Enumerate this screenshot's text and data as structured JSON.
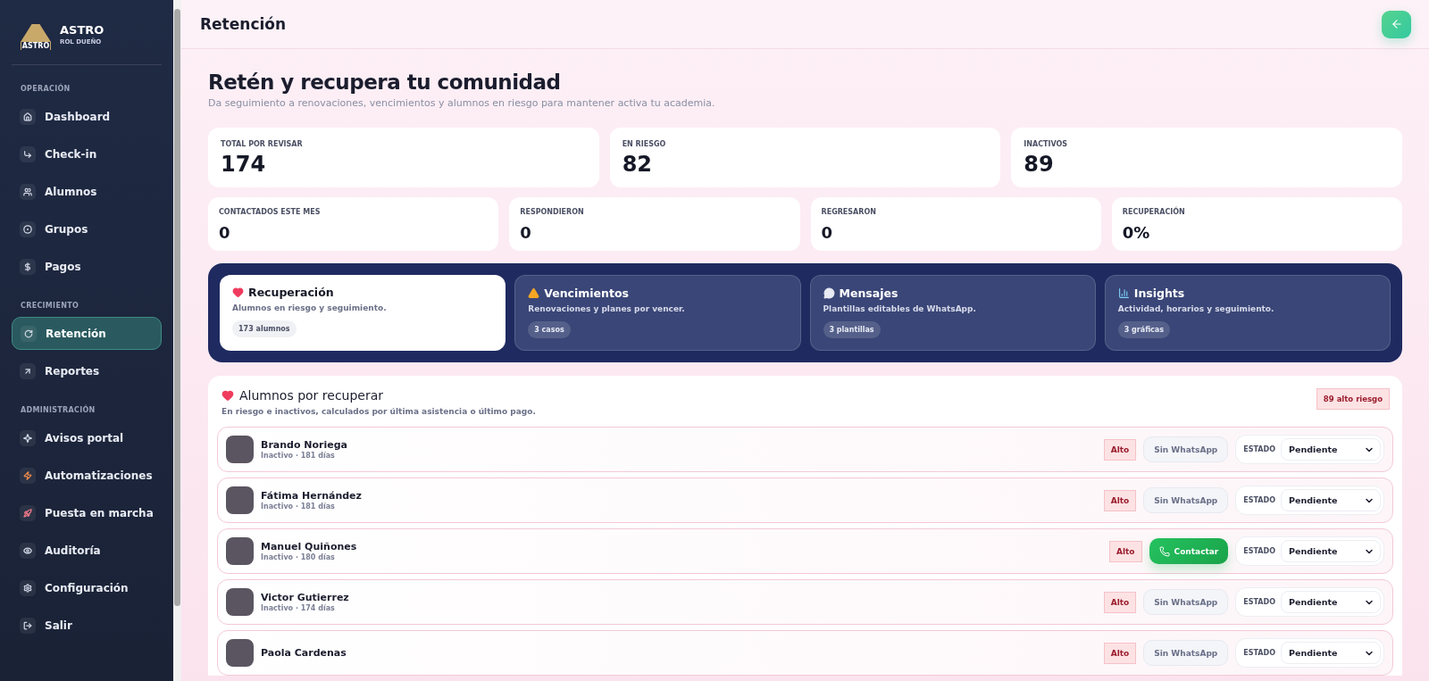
{
  "brand": {
    "name": "ASTRO",
    "logo_text": "ASTRO",
    "role": "ROL DUEÑO"
  },
  "sidebar": {
    "sections": [
      {
        "title": "OPERACIÓN",
        "items": [
          {
            "label": "Dashboard",
            "selected": false
          },
          {
            "label": "Check-in",
            "selected": false
          },
          {
            "label": "Alumnos",
            "selected": false
          },
          {
            "label": "Grupos",
            "selected": false
          },
          {
            "label": "Pagos",
            "selected": false
          }
        ]
      },
      {
        "title": "CRECIMIENTO",
        "items": [
          {
            "label": "Retención",
            "selected": true
          },
          {
            "label": "Reportes",
            "selected": false
          }
        ]
      },
      {
        "title": "ADMINISTRACIÓN",
        "items": [
          {
            "label": "Avisos portal",
            "selected": false
          },
          {
            "label": "Automatizaciones",
            "selected": false
          },
          {
            "label": "Puesta en marcha",
            "selected": false
          },
          {
            "label": "Auditoría",
            "selected": false
          },
          {
            "label": "Configuración",
            "selected": false
          },
          {
            "label": "Salir",
            "selected": false
          }
        ]
      }
    ]
  },
  "header": {
    "title": "Retención"
  },
  "hero": {
    "title": "Retén y recupera tu comunidad",
    "subtitle": "Da seguimiento a renovaciones, vencimientos y alumnos en riesgo para mantener activa tu academia."
  },
  "stats_primary": [
    {
      "label": "TOTAL POR REVISAR",
      "value": "174"
    },
    {
      "label": "EN RIESGO",
      "value": "82"
    },
    {
      "label": "INACTIVOS",
      "value": "89"
    }
  ],
  "stats_secondary": [
    {
      "label": "CONTACTADOS ESTE MES",
      "value": "0"
    },
    {
      "label": "RESPONDIERON",
      "value": "0"
    },
    {
      "label": "REGRESARON",
      "value": "0"
    },
    {
      "label": "RECUPERACIÓN",
      "value": "0%"
    }
  ],
  "tabs": [
    {
      "label": "Recuperación",
      "description": "Alumnos en riesgo y seguimiento.",
      "count": "173 alumnos",
      "selected": true
    },
    {
      "label": "Vencimientos",
      "description": "Renovaciones y planes por vencer.",
      "count": "3 casos",
      "selected": false
    },
    {
      "label": "Mensajes",
      "description": "Plantillas editables de WhatsApp.",
      "count": "3 plantillas",
      "selected": false
    },
    {
      "label": "Insights",
      "description": "Actividad, horarios y seguimiento.",
      "count": "3 gráficas",
      "selected": false
    }
  ],
  "list": {
    "title": "Alumnos por recuperar",
    "subtitle": "En riesgo e inactivos, calculados por última asistencia o último pago.",
    "badge": "89 alto riesgo",
    "rows": [
      {
        "name": "Brando Noriega",
        "detail": "Inactivo · 181 días",
        "risk": "Alto",
        "contact": {
          "kind": "none",
          "label": "Sin WhatsApp"
        },
        "status_label": "ESTADO",
        "status": "Pendiente"
      },
      {
        "name": "Fátima Hernández",
        "detail": "Inactivo · 181 días",
        "risk": "Alto",
        "contact": {
          "kind": "none",
          "label": "Sin WhatsApp"
        },
        "status_label": "ESTADO",
        "status": "Pendiente"
      },
      {
        "name": "Manuel Quiñones",
        "detail": "Inactivo · 180 días",
        "risk": "Alto",
        "contact": {
          "kind": "whatsapp",
          "label": "Contactar"
        },
        "status_label": "ESTADO",
        "status": "Pendiente"
      },
      {
        "name": "Victor Gutierrez",
        "detail": "Inactivo · 174 días",
        "risk": "Alto",
        "contact": {
          "kind": "none",
          "label": "Sin WhatsApp"
        },
        "status_label": "ESTADO",
        "status": "Pendiente"
      },
      {
        "name": "Paola Cardenas",
        "risk": "Alto",
        "contact": {
          "kind": "none",
          "label": "Sin WhatsApp"
        },
        "status_label": "ESTADO",
        "status": "Pendiente"
      }
    ]
  }
}
